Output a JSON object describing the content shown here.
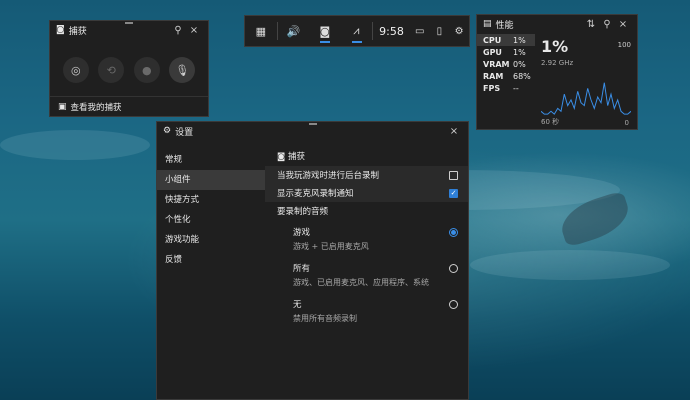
{
  "capture": {
    "title": "捕获",
    "pin_icon": "pin-icon",
    "close_icon": "×",
    "buttons": [
      "screenshot",
      "record-last",
      "start-recording",
      "mic-off"
    ],
    "footer": "查看我的捕获"
  },
  "gamebar": {
    "time": "9:58"
  },
  "perf": {
    "title": "性能",
    "rows": [
      {
        "k": "CPU",
        "v": "1%"
      },
      {
        "k": "GPU",
        "v": "1%"
      },
      {
        "k": "VRAM",
        "v": "0%"
      },
      {
        "k": "RAM",
        "v": "68%"
      },
      {
        "k": "FPS",
        "v": "--"
      }
    ],
    "big_value": "1%",
    "freq": "2.92 GHz",
    "max_label": "100",
    "axis_left": "60 秒",
    "axis_right": "0",
    "graph_values": [
      2,
      1,
      1,
      2,
      1,
      3,
      2,
      8,
      4,
      6,
      3,
      9,
      5,
      4,
      10,
      6,
      3,
      7,
      5,
      12,
      4,
      8,
      3,
      6,
      2,
      1,
      1,
      2
    ]
  },
  "settings": {
    "title": "设置",
    "nav": [
      "常规",
      "小组件",
      "快捷方式",
      "个性化",
      "游戏功能",
      "反馈"
    ],
    "selected_nav": 1,
    "section": "捕获",
    "options": [
      {
        "label": "当我玩游戏时进行后台录制",
        "checked": false
      },
      {
        "label": "显示麦克风录制通知",
        "checked": true
      }
    ],
    "audio_title": "要录制的音频",
    "audio": [
      {
        "title": "游戏",
        "desc": "游戏 + 已启用麦克风",
        "selected": true
      },
      {
        "title": "所有",
        "desc": "游戏、已启用麦克风、应用程序、系统",
        "selected": false
      },
      {
        "title": "无",
        "desc": "禁用所有音频录制",
        "selected": false
      }
    ]
  }
}
